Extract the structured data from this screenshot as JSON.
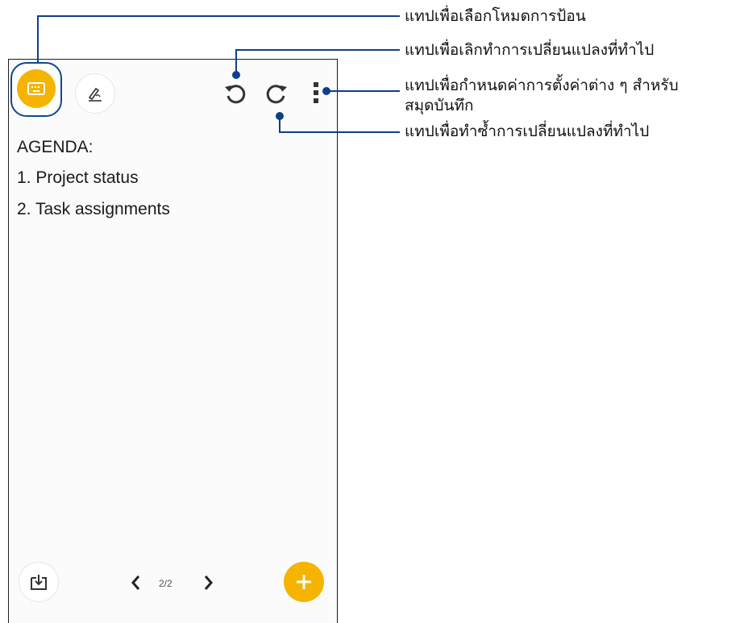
{
  "toolbar": {
    "keyboard_mode_icon": "keyboard-icon",
    "handwriting_mode_icon": "handwriting-pen-icon",
    "undo_icon": "undo-icon",
    "redo_icon": "redo-icon",
    "more_icon": "more-vertical-icon"
  },
  "note": {
    "lines": [
      "AGENDA:",
      "1. Project status",
      "2. Task assignments"
    ]
  },
  "bottom_bar": {
    "import_icon": "import-page-icon",
    "prev_icon": "chevron-left-icon",
    "page_indicator": "2/2",
    "next_icon": "chevron-right-icon",
    "add_icon": "plus-icon"
  },
  "callouts": {
    "input_mode": "แทปเพื่อเลือกโหมดการป้อน",
    "undo": "แทปเพื่อเลิกทำการเปลี่ยนแปลงที่ทำไป",
    "settings_line1": "แทปเพื่อกำหนดค่าการตั้งค่าต่าง ๆ สำหรับ",
    "settings_line2": "สมุดบันทึก",
    "redo": "แทปเพื่อทำซ้ำการเปลี่ยนแปลงที่ทำไป"
  },
  "colors": {
    "accent": "#f5b400",
    "callout": "#0f3f86"
  }
}
